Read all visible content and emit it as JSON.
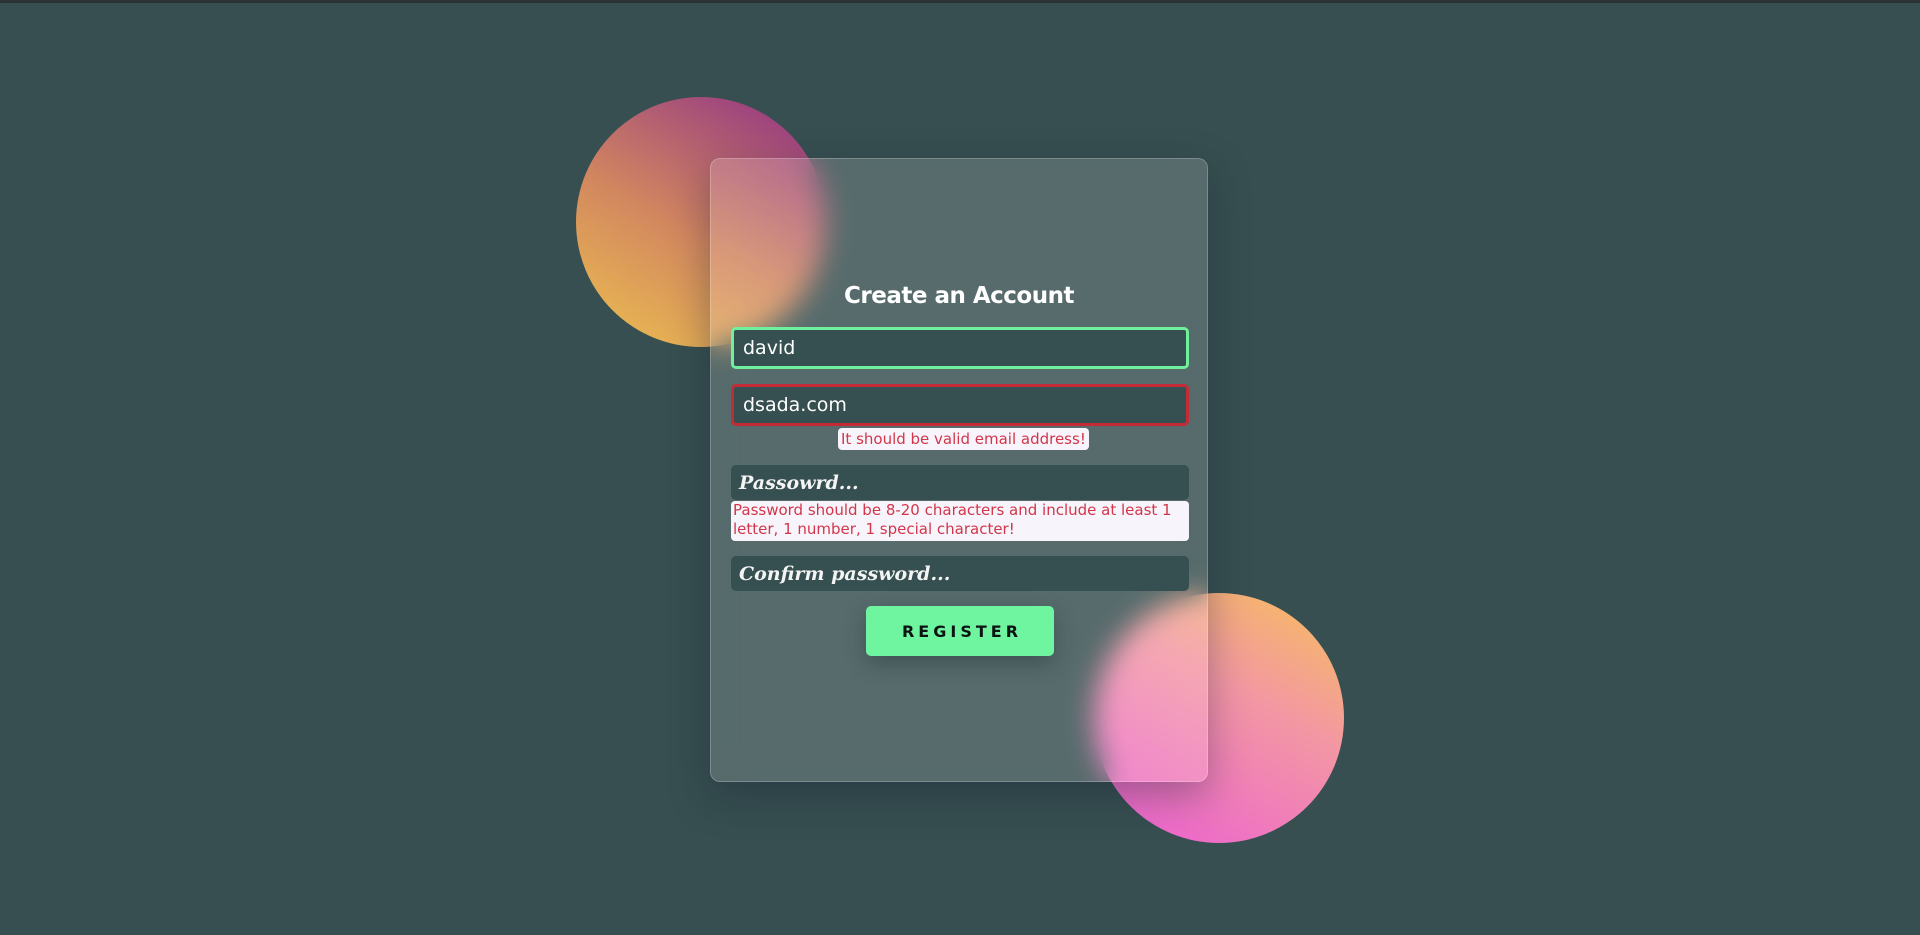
{
  "form": {
    "title": "Create an Account",
    "username": {
      "value": "david",
      "state": "valid"
    },
    "email": {
      "value": "dsada.com",
      "state": "invalid",
      "error": "It should be valid email address!"
    },
    "password": {
      "placeholder": "Passowrd...",
      "error": "Password should be 8-20 characters and include at least 1 letter, 1 number, 1 special character!"
    },
    "confirm_password": {
      "placeholder": "Confirm password..."
    },
    "register_label": "REGISTER"
  },
  "colors": {
    "background": "#374f50",
    "valid_border": "#6ef09c",
    "invalid_border": "#c32b36",
    "error_text": "#d2364a",
    "button": "#6ff4a0"
  }
}
